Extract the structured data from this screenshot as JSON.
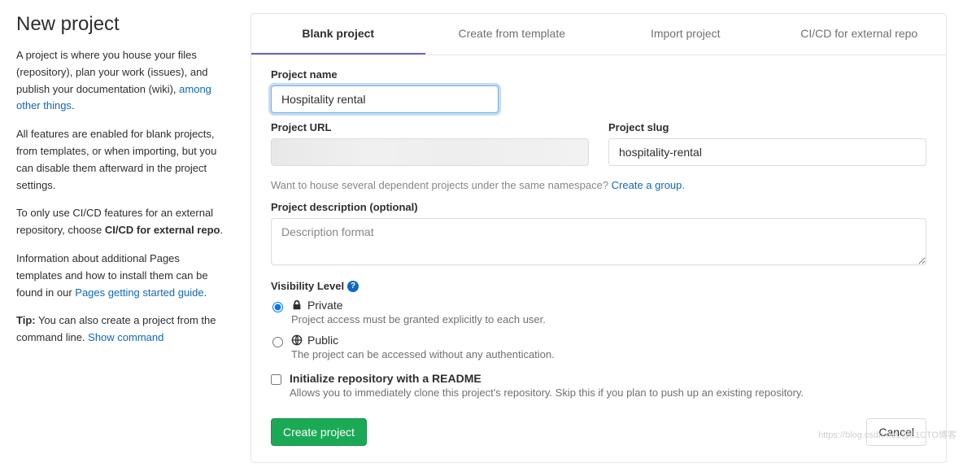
{
  "sidebar": {
    "title": "New project",
    "p1_a": "A project is where you house your files (repository), plan your work (issues), and publish your documentation (wiki), ",
    "p1_link": "among other things",
    "p1_b": ".",
    "p2": "All features are enabled for blank projects, from templates, or when importing, but you can disable them afterward in the project settings.",
    "p3_a": "To only use CI/CD features for an external repository, choose ",
    "p3_b": "CI/CD for external repo",
    "p3_c": ".",
    "p4_a": "Information about additional Pages templates and how to install them can be found in our ",
    "p4_link": "Pages getting started guide",
    "p4_b": ".",
    "p5_a": "Tip:",
    "p5_b": " You can also create a project from the command line. ",
    "p5_link": "Show command"
  },
  "tabs": {
    "blank": "Blank project",
    "template": "Create from template",
    "import": "Import project",
    "cicd": "CI/CD for external repo"
  },
  "form": {
    "project_name_label": "Project name",
    "project_name_value": "Hospitality rental",
    "project_url_label": "Project URL",
    "project_slug_label": "Project slug",
    "project_slug_value": "hospitality-rental",
    "group_help_a": "Want to house several dependent projects under the same namespace? ",
    "group_help_link": "Create a group.",
    "description_label": "Project description (optional)",
    "description_placeholder": "Description format",
    "visibility_label": "Visibility Level",
    "visibility": {
      "private": {
        "title": "Private",
        "desc": "Project access must be granted explicitly to each user."
      },
      "public": {
        "title": "Public",
        "desc": "The project can be accessed without any authentication."
      }
    },
    "readme": {
      "title": "Initialize repository with a README",
      "desc": "Allows you to immediately clone this project's repository. Skip this if you plan to push up an existing repository."
    },
    "create_label": "Create project",
    "cancel_label": "Cancel"
  },
  "watermark": "https://blog.csdn.net/@51CTO博客"
}
